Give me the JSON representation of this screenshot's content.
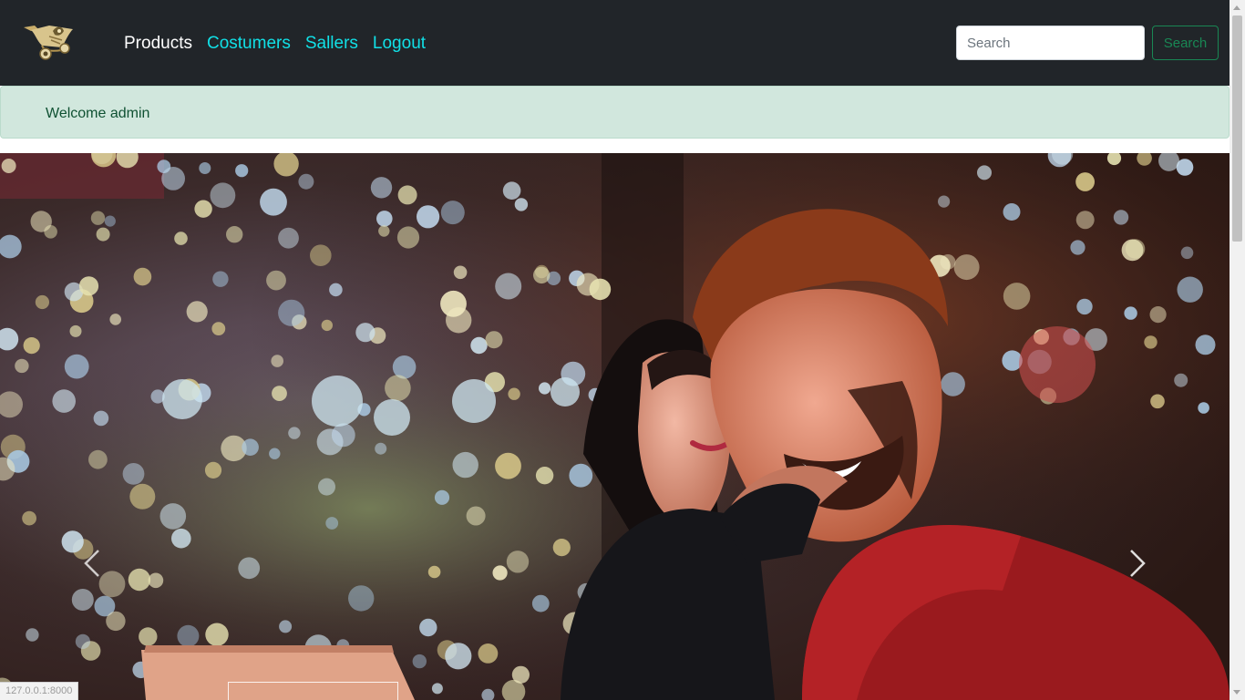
{
  "navbar": {
    "logo": "cart-logo-icon",
    "links": [
      {
        "label": "Products"
      },
      {
        "label": "Costumers"
      },
      {
        "label": "Sallers"
      },
      {
        "label": "Logout"
      }
    ],
    "search": {
      "placeholder": "Search",
      "button_label": "Search"
    },
    "colors": {
      "background": "#212529",
      "active_link": "#ffffff",
      "link": "#11e0e6",
      "search_button": "#198754"
    }
  },
  "alert": {
    "message": "Welcome admin",
    "color": "#d1e7dd"
  },
  "carousel": {
    "image": "couple-looking-at-laptop-bokeh-lights-image",
    "prev_icon": "chevron-left-icon",
    "next_icon": "chevron-right-icon"
  },
  "status_bar": {
    "url": "127.0.0.1:8000"
  }
}
